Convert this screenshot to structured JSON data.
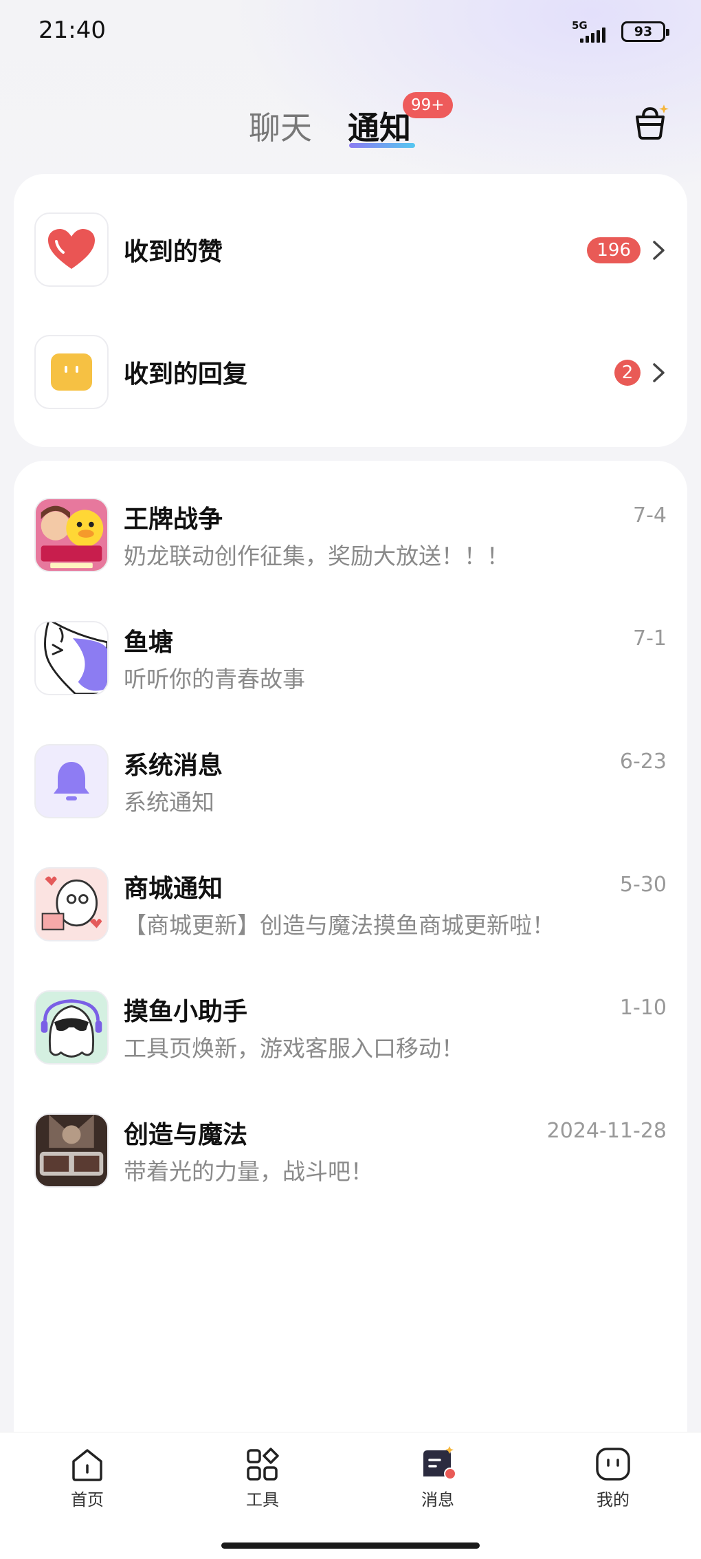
{
  "status_bar": {
    "time": "21:40",
    "network": "5G",
    "battery": "93"
  },
  "header": {
    "tabs": [
      {
        "label": "聊天",
        "active": false
      },
      {
        "label": "通知",
        "active": true
      }
    ],
    "notify_badge": "99+"
  },
  "interactions": [
    {
      "title": "收到的赞",
      "count": "196",
      "icon": "heart-icon"
    },
    {
      "title": "收到的回复",
      "count": "2",
      "icon": "reply-face-icon"
    }
  ],
  "notifications": [
    {
      "title": "王牌战争",
      "subtitle": "奶龙联动创作征集，奖励大放送！！！",
      "date": "7-4",
      "icon": "game-avatar-icon"
    },
    {
      "title": "鱼塘",
      "subtitle": "听听你的青春故事",
      "date": "7-1",
      "icon": "fish-icon"
    },
    {
      "title": "系统消息",
      "subtitle": "系统通知",
      "date": "6-23",
      "icon": "bell-icon"
    },
    {
      "title": "商城通知",
      "subtitle": "【商城更新】创造与魔法摸鱼商城更新啦！",
      "date": "5-30",
      "icon": "gift-mascot-icon"
    },
    {
      "title": "摸鱼小助手",
      "subtitle": "工具页焕新，游戏客服入口移动！",
      "date": "1-10",
      "icon": "assistant-mascot-icon"
    },
    {
      "title": "创造与魔法",
      "subtitle": "带着光的力量，战斗吧！",
      "date": "2024-11-28",
      "icon": "game-logo-icon"
    }
  ],
  "bottom_nav": [
    {
      "label": "首页",
      "icon": "home-icon"
    },
    {
      "label": "工具",
      "icon": "tools-icon"
    },
    {
      "label": "消息",
      "icon": "message-icon",
      "active": true
    },
    {
      "label": "我的",
      "icon": "profile-icon"
    }
  ],
  "colors": {
    "badge_red": "#e95a56",
    "heart_red": "#ea5554",
    "bell_purple": "#8e7cf3",
    "tab_gradient_start": "#8b7bf1",
    "tab_gradient_end": "#55c7f0"
  }
}
